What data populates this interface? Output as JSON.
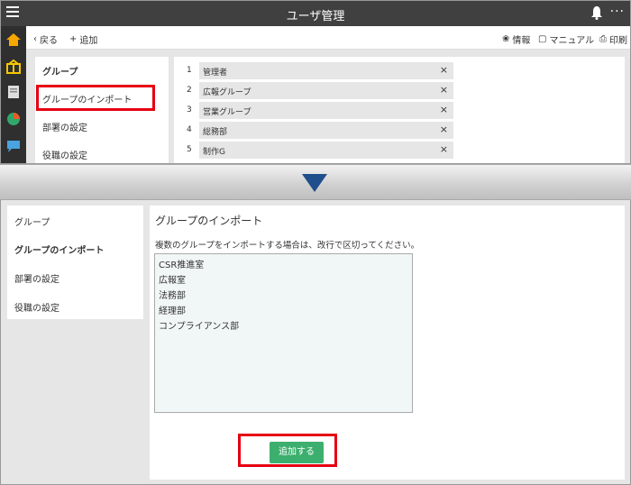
{
  "top": {
    "title": "ユーザ管理",
    "toolbar": {
      "back_label": "戻る",
      "add_label": "追加",
      "info_label": "情報",
      "manual_label": "マニュアル",
      "print_label": "印刷"
    },
    "nav": {
      "items": [
        {
          "label": "グループ"
        },
        {
          "label": "グループのインポート"
        },
        {
          "label": "部署の設定"
        },
        {
          "label": "役職の設定"
        }
      ]
    },
    "groups": [
      {
        "num": "1",
        "name": "管理者"
      },
      {
        "num": "2",
        "name": "広報グループ"
      },
      {
        "num": "3",
        "name": "営業グループ"
      },
      {
        "num": "4",
        "name": "総務部"
      },
      {
        "num": "5",
        "name": "制作G"
      }
    ],
    "remove_glyph": "×",
    "more_glyph": "···"
  },
  "bottom": {
    "nav": {
      "items": [
        {
          "label": "グループ"
        },
        {
          "label": "グループのインポート"
        },
        {
          "label": "部署の設定"
        },
        {
          "label": "役職の設定"
        }
      ]
    },
    "panel": {
      "title": "グループのインポート",
      "description": "複数のグループをインポートする場合は、改行で区切ってください。",
      "textarea_lines": [
        "CSR推進室",
        "広報室",
        "法務部",
        "経理部",
        "コンプライアンス部"
      ],
      "add_button_label": "追加する"
    }
  },
  "colors": {
    "highlight": "#e60012",
    "add_button": "#3caf6e",
    "titlebar": "#404040",
    "arrow": "#1f4e8c"
  }
}
